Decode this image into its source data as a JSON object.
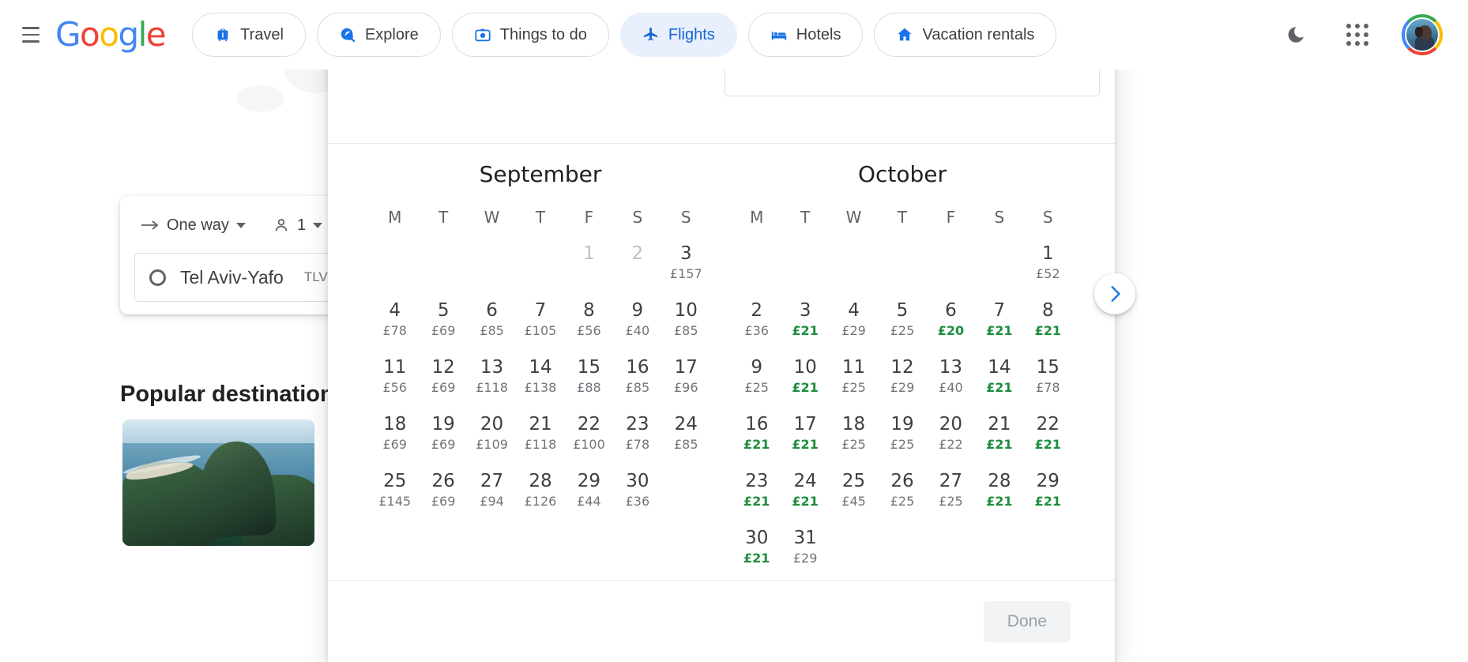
{
  "header": {
    "menu_icon": "hamburger-menu-icon",
    "logo": {
      "text": "Google",
      "letters": [
        "G",
        "o",
        "o",
        "g",
        "l",
        "e"
      ]
    },
    "nav": [
      {
        "label": "Travel",
        "icon": "luggage-icon",
        "active": false
      },
      {
        "label": "Explore",
        "icon": "explore-globe-icon",
        "active": false
      },
      {
        "label": "Things to do",
        "icon": "camera-icon",
        "active": false
      },
      {
        "label": "Flights",
        "icon": "airplane-icon",
        "active": true
      },
      {
        "label": "Hotels",
        "icon": "bed-icon",
        "active": false
      },
      {
        "label": "Vacation rentals",
        "icon": "house-icon",
        "active": false
      }
    ],
    "dark_mode_icon": "moon-icon",
    "apps_icon": "apps-grid-icon",
    "avatar": "user-avatar"
  },
  "search": {
    "trip_type": "One way",
    "trip_type_icon": "arrow-right-icon",
    "passengers_icon": "person-icon",
    "passengers": "1",
    "origin_icon": "origin-circle-icon",
    "origin_city": "Tel Aviv-Yafo",
    "origin_code": "TLV"
  },
  "popular": {
    "title": "Popular destinations",
    "card_image": "rio-de-janeiro-coast-photo"
  },
  "calendar": {
    "next_month_icon": "chevron-right-icon",
    "done_label": "Done",
    "done_enabled": false,
    "currency": "£",
    "day_labels": [
      "M",
      "T",
      "W",
      "T",
      "F",
      "S",
      "S"
    ],
    "months": [
      {
        "name": "September",
        "lead_blanks": 4,
        "days": [
          {
            "num": "1",
            "price": "",
            "disabled": true,
            "cheap": false
          },
          {
            "num": "2",
            "price": "",
            "disabled": true,
            "cheap": false
          },
          {
            "num": "3",
            "price": "£157",
            "disabled": false,
            "cheap": false
          },
          {
            "num": "4",
            "price": "£78",
            "disabled": false,
            "cheap": false
          },
          {
            "num": "5",
            "price": "£69",
            "disabled": false,
            "cheap": false
          },
          {
            "num": "6",
            "price": "£85",
            "disabled": false,
            "cheap": false
          },
          {
            "num": "7",
            "price": "£105",
            "disabled": false,
            "cheap": false
          },
          {
            "num": "8",
            "price": "£56",
            "disabled": false,
            "cheap": false
          },
          {
            "num": "9",
            "price": "£40",
            "disabled": false,
            "cheap": false
          },
          {
            "num": "10",
            "price": "£85",
            "disabled": false,
            "cheap": false
          },
          {
            "num": "11",
            "price": "£56",
            "disabled": false,
            "cheap": false
          },
          {
            "num": "12",
            "price": "£69",
            "disabled": false,
            "cheap": false
          },
          {
            "num": "13",
            "price": "£118",
            "disabled": false,
            "cheap": false
          },
          {
            "num": "14",
            "price": "£138",
            "disabled": false,
            "cheap": false
          },
          {
            "num": "15",
            "price": "£88",
            "disabled": false,
            "cheap": false
          },
          {
            "num": "16",
            "price": "£85",
            "disabled": false,
            "cheap": false
          },
          {
            "num": "17",
            "price": "£96",
            "disabled": false,
            "cheap": false
          },
          {
            "num": "18",
            "price": "£69",
            "disabled": false,
            "cheap": false
          },
          {
            "num": "19",
            "price": "£69",
            "disabled": false,
            "cheap": false
          },
          {
            "num": "20",
            "price": "£109",
            "disabled": false,
            "cheap": false
          },
          {
            "num": "21",
            "price": "£118",
            "disabled": false,
            "cheap": false
          },
          {
            "num": "22",
            "price": "£100",
            "disabled": false,
            "cheap": false
          },
          {
            "num": "23",
            "price": "£78",
            "disabled": false,
            "cheap": false
          },
          {
            "num": "24",
            "price": "£85",
            "disabled": false,
            "cheap": false
          },
          {
            "num": "25",
            "price": "£145",
            "disabled": false,
            "cheap": false
          },
          {
            "num": "26",
            "price": "£69",
            "disabled": false,
            "cheap": false
          },
          {
            "num": "27",
            "price": "£94",
            "disabled": false,
            "cheap": false
          },
          {
            "num": "28",
            "price": "£126",
            "disabled": false,
            "cheap": false
          },
          {
            "num": "29",
            "price": "£44",
            "disabled": false,
            "cheap": false
          },
          {
            "num": "30",
            "price": "£36",
            "disabled": false,
            "cheap": false
          }
        ]
      },
      {
        "name": "October",
        "lead_blanks": 6,
        "days": [
          {
            "num": "1",
            "price": "£52",
            "disabled": false,
            "cheap": false
          },
          {
            "num": "2",
            "price": "£36",
            "disabled": false,
            "cheap": false
          },
          {
            "num": "3",
            "price": "£21",
            "disabled": false,
            "cheap": true
          },
          {
            "num": "4",
            "price": "£29",
            "disabled": false,
            "cheap": false
          },
          {
            "num": "5",
            "price": "£25",
            "disabled": false,
            "cheap": false
          },
          {
            "num": "6",
            "price": "£20",
            "disabled": false,
            "cheap": true
          },
          {
            "num": "7",
            "price": "£21",
            "disabled": false,
            "cheap": true
          },
          {
            "num": "8",
            "price": "£21",
            "disabled": false,
            "cheap": true
          },
          {
            "num": "9",
            "price": "£25",
            "disabled": false,
            "cheap": false
          },
          {
            "num": "10",
            "price": "£21",
            "disabled": false,
            "cheap": true
          },
          {
            "num": "11",
            "price": "£25",
            "disabled": false,
            "cheap": false
          },
          {
            "num": "12",
            "price": "£29",
            "disabled": false,
            "cheap": false
          },
          {
            "num": "13",
            "price": "£40",
            "disabled": false,
            "cheap": false
          },
          {
            "num": "14",
            "price": "£21",
            "disabled": false,
            "cheap": true
          },
          {
            "num": "15",
            "price": "£78",
            "disabled": false,
            "cheap": false
          },
          {
            "num": "16",
            "price": "£21",
            "disabled": false,
            "cheap": true
          },
          {
            "num": "17",
            "price": "£21",
            "disabled": false,
            "cheap": true
          },
          {
            "num": "18",
            "price": "£25",
            "disabled": false,
            "cheap": false
          },
          {
            "num": "19",
            "price": "£25",
            "disabled": false,
            "cheap": false
          },
          {
            "num": "20",
            "price": "£22",
            "disabled": false,
            "cheap": false
          },
          {
            "num": "21",
            "price": "£21",
            "disabled": false,
            "cheap": true
          },
          {
            "num": "22",
            "price": "£21",
            "disabled": false,
            "cheap": true
          },
          {
            "num": "23",
            "price": "£21",
            "disabled": false,
            "cheap": true
          },
          {
            "num": "24",
            "price": "£21",
            "disabled": false,
            "cheap": true
          },
          {
            "num": "25",
            "price": "£45",
            "disabled": false,
            "cheap": false
          },
          {
            "num": "26",
            "price": "£25",
            "disabled": false,
            "cheap": false
          },
          {
            "num": "27",
            "price": "£25",
            "disabled": false,
            "cheap": false
          },
          {
            "num": "28",
            "price": "£21",
            "disabled": false,
            "cheap": true
          },
          {
            "num": "29",
            "price": "£21",
            "disabled": false,
            "cheap": true
          },
          {
            "num": "30",
            "price": "£21",
            "disabled": false,
            "cheap": true
          },
          {
            "num": "31",
            "price": "£29",
            "disabled": false,
            "cheap": false
          }
        ]
      }
    ]
  },
  "colors": {
    "accent_blue": "#1a73e8",
    "active_pill_bg": "#e8f0fe",
    "cheap_price_green": "#1e8e3e",
    "text_primary": "#3c4043",
    "text_secondary": "#70757a",
    "disabled_text": "#bdc1c6"
  }
}
